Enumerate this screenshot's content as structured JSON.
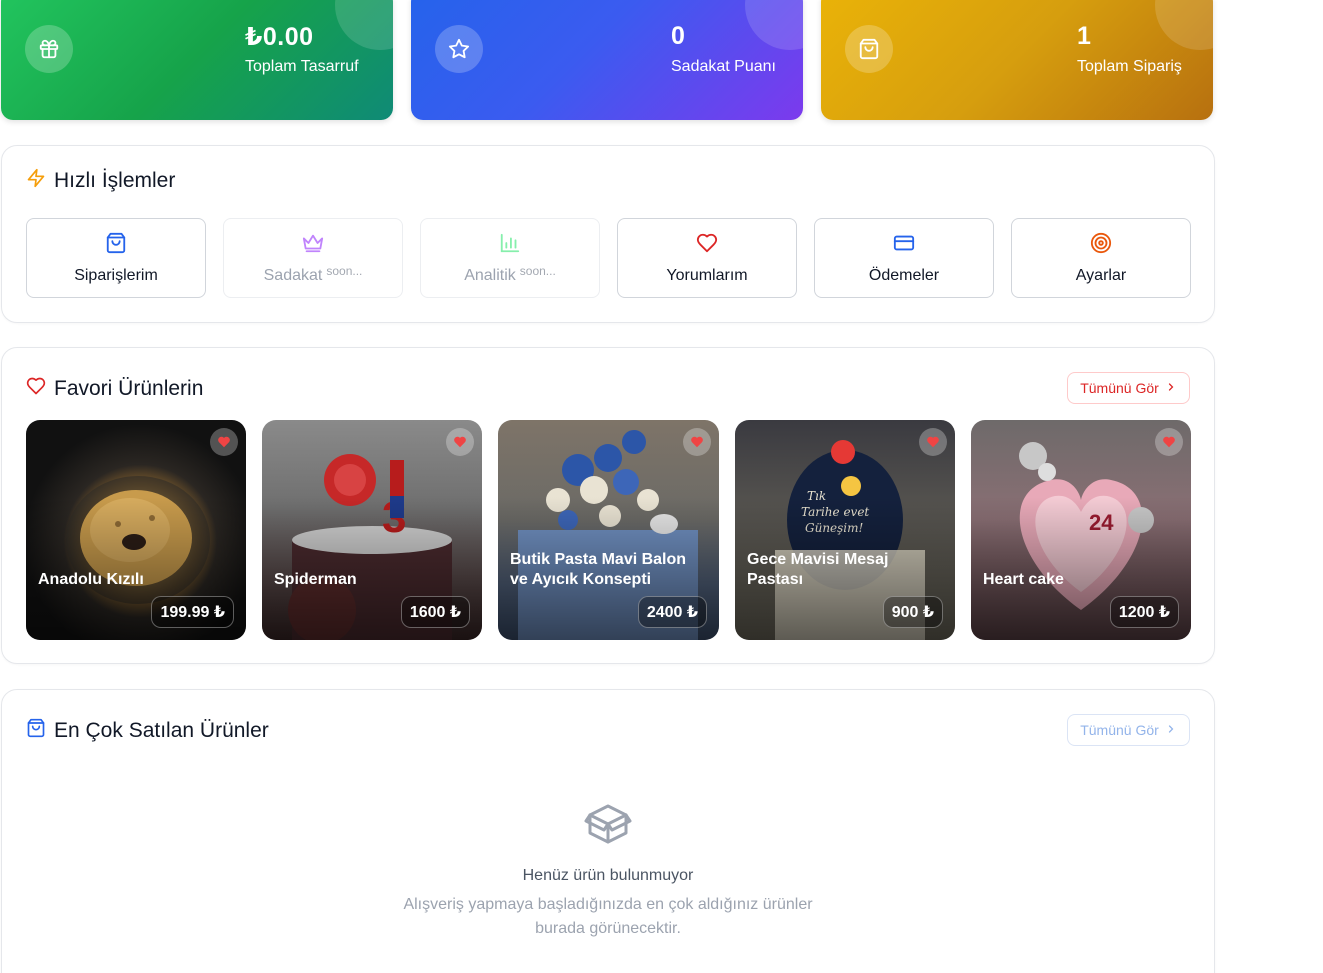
{
  "stats": [
    {
      "value": "₺0.00",
      "label": "Toplam Tasarruf",
      "icon": "gift-icon"
    },
    {
      "value": "0",
      "label": "Sadakat Puanı",
      "icon": "star-icon"
    },
    {
      "value": "1",
      "label": "Toplam Sipariş",
      "icon": "shopping-bag-icon"
    }
  ],
  "quick_actions": {
    "title": "Hızlı İşlemler",
    "items": [
      {
        "label": "Siparişlerim",
        "soon": "",
        "icon": "shopping-bag-icon",
        "color": "#2563eb"
      },
      {
        "label": "Sadakat",
        "soon": "soon...",
        "icon": "crown-icon",
        "color": "#a855f7"
      },
      {
        "label": "Analitik",
        "soon": "soon...",
        "icon": "bar-chart-icon",
        "color": "#22c55e"
      },
      {
        "label": "Yorumlarım",
        "soon": "",
        "icon": "heart-icon",
        "color": "#dc2626"
      },
      {
        "label": "Ödemeler",
        "soon": "",
        "icon": "credit-card-icon",
        "color": "#2563eb"
      },
      {
        "label": "Ayarlar",
        "soon": "",
        "icon": "target-icon",
        "color": "#ea580c"
      }
    ]
  },
  "favorites": {
    "title": "Favori Ürünlerin",
    "see_all": "Tümünü Gör",
    "items": [
      {
        "name": "Anadolu Kızılı",
        "price": "199.99 ₺"
      },
      {
        "name": "Spiderman",
        "price": "1600 ₺"
      },
      {
        "name": "Butik Pasta Mavi Balon ve Ayıcık Konsepti",
        "price": "2400 ₺"
      },
      {
        "name": "Gece Mavisi Mesaj Pastası",
        "price": "900 ₺"
      },
      {
        "name": "Heart cake",
        "price": "1200 ₺"
      }
    ]
  },
  "best_sellers": {
    "title": "En Çok Satılan Ürünler",
    "see_all": "Tümünü Gör",
    "empty_title": "Henüz ürün bulunmuyor",
    "empty_text": "Alışveriş yapmaya başladığınızda en çok aldığınız ürünler burada görünecektir."
  },
  "colors": {
    "accent_red": "#dc2626",
    "accent_blue": "#2563eb",
    "quick_action_title_icon": "#f59e0b"
  }
}
